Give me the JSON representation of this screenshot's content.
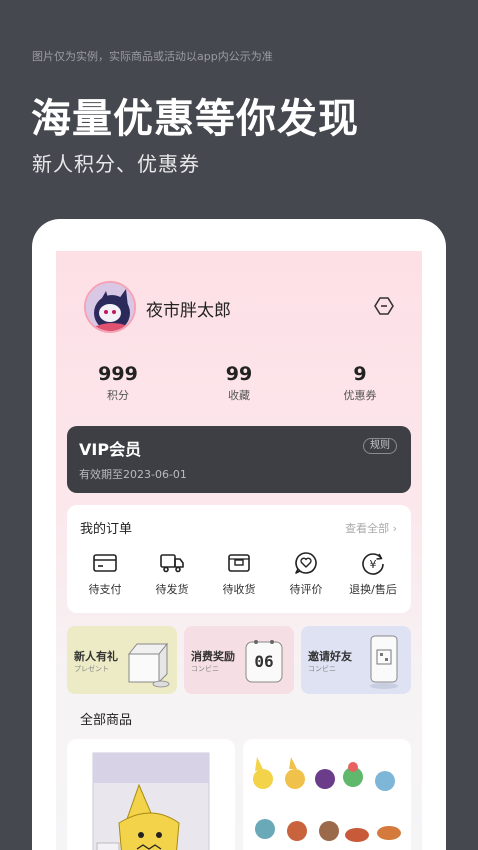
{
  "banner": {
    "disclaimer": "图片仅为实例，实际商品或活动以app内公示为准",
    "headline": "海量优惠等你发现",
    "subhead": "新人积分、优惠券"
  },
  "profile": {
    "username": "夜市胖太郎"
  },
  "stats": [
    {
      "value": "999",
      "label": "积分"
    },
    {
      "value": "99",
      "label": "收藏"
    },
    {
      "value": "9",
      "label": "优惠券"
    }
  ],
  "vip": {
    "title": "VIP会员",
    "expire": "有效期至2023-06-01",
    "rules": "规则"
  },
  "orders": {
    "title": "我的订单",
    "view_all": "查看全部 ›",
    "items": [
      {
        "label": "待支付",
        "icon": "card-icon"
      },
      {
        "label": "待发货",
        "icon": "truck-icon"
      },
      {
        "label": "待收货",
        "icon": "receive-box-icon"
      },
      {
        "label": "待评价",
        "icon": "heart-chat-icon"
      },
      {
        "label": "退换/售后",
        "icon": "yen-refund-icon"
      }
    ]
  },
  "promos": [
    {
      "title": "新人有礼",
      "subtitle": "プレゼント",
      "bg": "#ecebc6"
    },
    {
      "title": "消费奖励",
      "subtitle": "コンビニ",
      "bg": "#f6dfe4",
      "calendar_day": "06"
    },
    {
      "title": "邀请好友",
      "subtitle": "コンビニ",
      "bg": "#dfe2f3"
    }
  ],
  "products": {
    "section_title": "全部商品"
  },
  "colors": {
    "background": "#46484f",
    "vip_card": "#3e3f45",
    "avatar_border": "#f4a2b4"
  }
}
